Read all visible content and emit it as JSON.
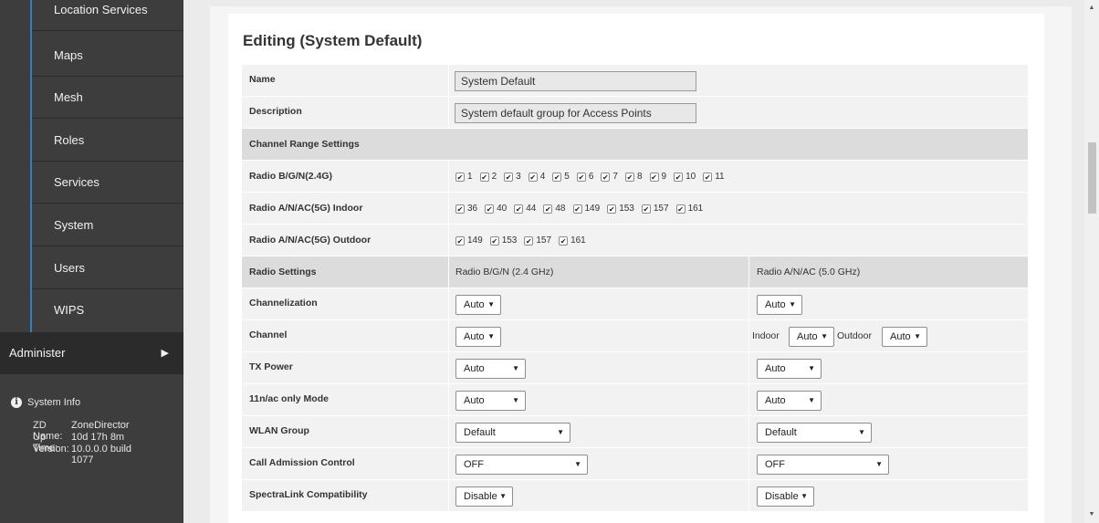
{
  "sidebar": {
    "items": [
      {
        "label": "Location Services"
      },
      {
        "label": "Maps"
      },
      {
        "label": "Mesh"
      },
      {
        "label": "Roles"
      },
      {
        "label": "Services"
      },
      {
        "label": "System"
      },
      {
        "label": "Users"
      },
      {
        "label": "WIPS"
      }
    ],
    "administer": "Administer",
    "administer_arrow": "▶",
    "system_info": {
      "title": "System Info",
      "zd_name_label": "ZD Name:",
      "zd_name_value": "ZoneDirector",
      "uptime_label": "Up Time:",
      "uptime_value": "10d 17h 8m",
      "version_label": "Version:",
      "version_value": "10.0.0.0 build 1077"
    }
  },
  "page": {
    "title": "Editing (System Default)"
  },
  "form": {
    "name_label": "Name",
    "name_value": "System Default",
    "description_label": "Description",
    "description_value": "System default group for Access Points",
    "channel_range_label": "Channel Range Settings",
    "radio_bgn_label": "Radio B/G/N(2.4G)",
    "radio_bgn_channels": [
      "1",
      "2",
      "3",
      "4",
      "5",
      "6",
      "7",
      "8",
      "9",
      "10",
      "11"
    ],
    "radio_5g_indoor_label": "Radio A/N/AC(5G) Indoor",
    "radio_5g_indoor_channels": [
      "36",
      "40",
      "44",
      "48",
      "149",
      "153",
      "157",
      "161"
    ],
    "radio_5g_outdoor_label": "Radio A/N/AC(5G) Outdoor",
    "radio_5g_outdoor_channels": [
      "149",
      "153",
      "157",
      "161"
    ],
    "radio_settings_label": "Radio Settings",
    "col_24_label": "Radio B/G/N (2.4 GHz)",
    "col_5_label": "Radio A/N/AC (5.0 GHz)",
    "channelization_label": "Channelization",
    "channelization_24": "Auto",
    "channelization_5": "Auto",
    "channel_label": "Channel",
    "channel_24": "Auto",
    "indoor_label": "Indoor",
    "channel_5_indoor": "Auto",
    "outdoor_label": "Outdoor",
    "channel_5_outdoor": "Auto",
    "tx_power_label": "TX Power",
    "tx_power_24": "Auto",
    "tx_power_5": "Auto",
    "n_only_label": "11n/ac only Mode",
    "n_only_24": "Auto",
    "n_only_5": "Auto",
    "wlan_group_label": "WLAN Group",
    "wlan_group_24": "Default",
    "wlan_group_5": "Default",
    "cac_label": "Call Admission Control",
    "cac_24": "OFF",
    "cac_5": "OFF",
    "spectralink_label": "SpectraLink Compatibility",
    "spectralink_24": "Disable",
    "spectralink_5": "Disable"
  },
  "glyphs": {
    "check": "✔",
    "caret": "▼",
    "scroll_up": "▲",
    "scroll_down": "▼",
    "info": "i"
  },
  "colors": {
    "accent": "#2e7fc6",
    "sidebar_bg": "#3d3d3d",
    "sidebar_dark": "#2b2b2b",
    "section_bg": "#dcdcdc",
    "row_bg": "#f2f2f2"
  }
}
